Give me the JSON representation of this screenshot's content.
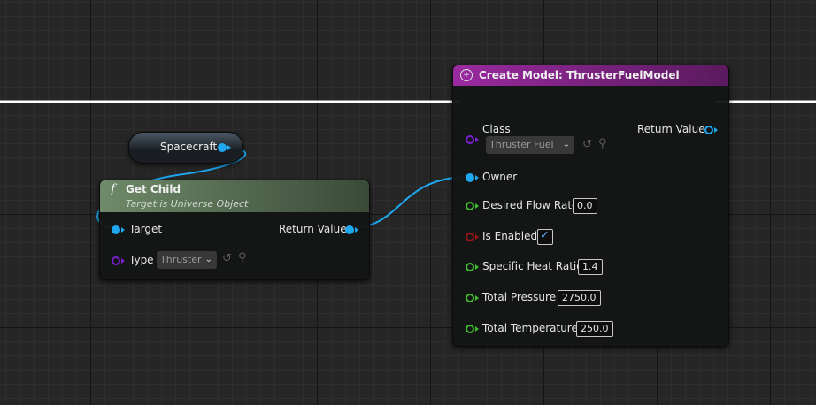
{
  "colors": {
    "object_pin": "#1ea8f0",
    "class_pin": "#7b1fd0",
    "float_pin": "#3fbd2d",
    "bool_pin": "#9a1515",
    "create_header": "#8c1e8e",
    "function_header": "#5f7d58"
  },
  "spacecraft_node": {
    "label": "Spacecraft"
  },
  "get_child_node": {
    "icon": "function-icon",
    "icon_glyph": "f",
    "title": "Get Child",
    "subtitle": "Target is Universe Object",
    "pins": {
      "target": "Target",
      "return_value": "Return Value",
      "type": "Type"
    },
    "type_value": "Thruster"
  },
  "create_model_node": {
    "icon": "create-model-icon",
    "title": "Create Model: ThrusterFuelModel",
    "pins": {
      "class": "Class",
      "class_value": "Thruster Fuel M",
      "return_value": "Return Value",
      "owner": "Owner",
      "desired_flow_rate": "Desired Flow Rate",
      "desired_flow_rate_value": "0.0",
      "is_enabled": "Is Enabled",
      "specific_heat_ratio": "Specific Heat Ratio",
      "specific_heat_ratio_value": "1.4",
      "total_pressure": "Total Pressure",
      "total_pressure_value": "2750.0",
      "total_temperature": "Total Temperature",
      "total_temperature_value": "250.0"
    },
    "is_enabled_checked": true
  }
}
